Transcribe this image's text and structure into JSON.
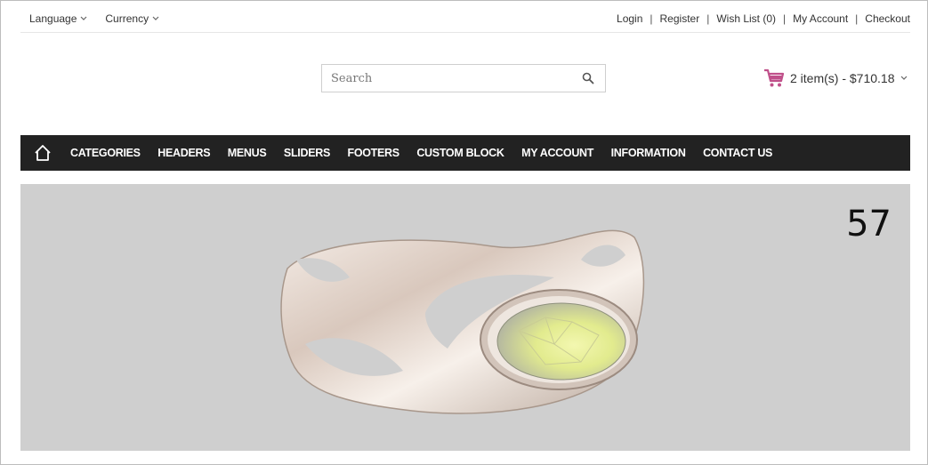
{
  "topbar": {
    "language_label": "Language",
    "currency_label": "Currency",
    "links": [
      "Login",
      "Register",
      "Wish List (0)",
      "My Account",
      "Checkout"
    ]
  },
  "search": {
    "placeholder": "Search"
  },
  "cart": {
    "summary": "2 item(s) - $710.18",
    "icon_color": "#c0508a"
  },
  "nav": {
    "items": [
      "CATEGORIES",
      "HEADERS",
      "MENUS",
      "SLIDERS",
      "FOOTERS",
      "CUSTOM BLOCK",
      "MY ACCOUNT",
      "INFORMATION",
      "CONTACT US"
    ],
    "background": "#222222"
  },
  "slider": {
    "counter": "57",
    "background": "#cfcfcf",
    "image_icon": "ring-image"
  }
}
